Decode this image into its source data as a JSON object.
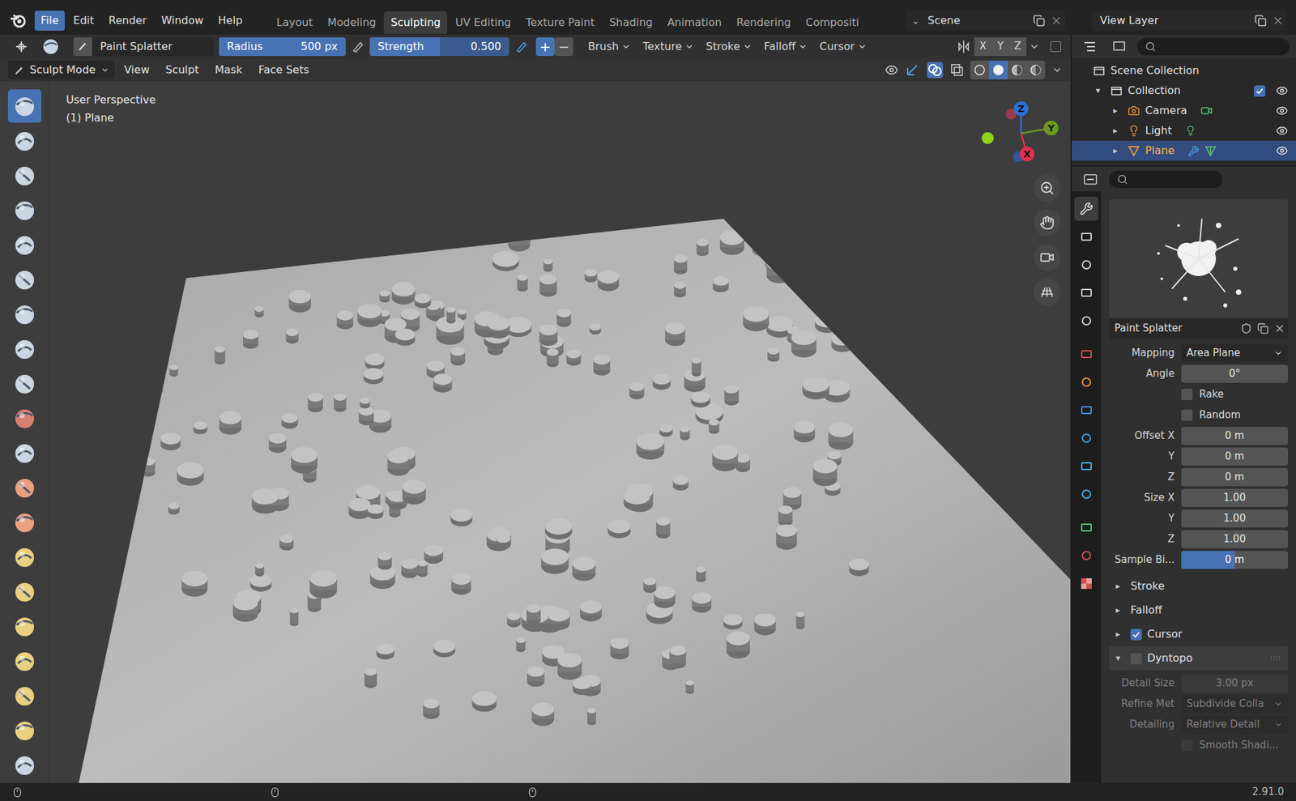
{
  "topbar": {
    "menus": [
      {
        "label": "File",
        "highlighted": true
      },
      {
        "label": "Edit",
        "highlighted": false
      },
      {
        "label": "Render",
        "highlighted": false
      },
      {
        "label": "Window",
        "highlighted": false
      },
      {
        "label": "Help",
        "highlighted": false
      }
    ],
    "workspaces": [
      {
        "label": "Layout",
        "selected": false
      },
      {
        "label": "Modeling",
        "selected": false
      },
      {
        "label": "Sculpting",
        "selected": true
      },
      {
        "label": "UV Editing",
        "selected": false
      },
      {
        "label": "Texture Paint",
        "selected": false
      },
      {
        "label": "Shading",
        "selected": false
      },
      {
        "label": "Animation",
        "selected": false
      },
      {
        "label": "Rendering",
        "selected": false
      },
      {
        "label": "Compositi",
        "selected": false
      }
    ],
    "scene": "Scene",
    "view_layer": "View Layer"
  },
  "tool_header": {
    "brush_name": "Paint Splatter",
    "radius": {
      "label": "Radius",
      "value": "500 px",
      "level": 1
    },
    "strength": {
      "label": "Strength",
      "value": "0.500",
      "level": 0.5
    },
    "direction": [
      {
        "label": "+",
        "selected": true
      },
      {
        "label": "−",
        "selected": false
      }
    ],
    "dropdowns": [
      "Brush",
      "Texture",
      "Stroke",
      "Falloff",
      "Cursor"
    ],
    "symmetry": [
      {
        "label": "X",
        "selected": false
      },
      {
        "label": "Y",
        "selected": false
      },
      {
        "label": "Z",
        "selected": false
      }
    ]
  },
  "mode_header": {
    "mode": "Sculpt Mode",
    "menus": [
      "View",
      "Sculpt",
      "Mask",
      "Face Sets"
    ],
    "shading": [
      {
        "selected": false
      },
      {
        "selected": true
      },
      {
        "selected": false
      },
      {
        "selected": false
      }
    ]
  },
  "toolbar": {
    "tools": [
      {
        "selected": true
      },
      {
        "selected": false
      },
      {
        "selected": false
      },
      {
        "selected": false
      },
      {
        "selected": false
      },
      {
        "selected": false
      },
      {
        "selected": false
      },
      {
        "selected": false
      },
      {
        "selected": false
      },
      {
        "selected": false
      },
      {
        "selected": false
      },
      {
        "selected": false
      },
      {
        "selected": false
      },
      {
        "selected": false
      },
      {
        "selected": false
      },
      {
        "selected": false
      },
      {
        "selected": false
      },
      {
        "selected": false
      },
      {
        "selected": false
      },
      {
        "selected": false
      }
    ]
  },
  "viewport": {
    "perspective": "User Perspective",
    "object": "(1) Plane",
    "gizmo": [
      "Z",
      "Y",
      "X"
    ]
  },
  "outliner": {
    "scene_collection": "Scene Collection",
    "collection": {
      "label": "Collection",
      "arrow": "▾",
      "checked": true,
      "visible": true
    },
    "objects": [
      {
        "label": "Camera",
        "arrow": "▸",
        "selected": false,
        "visible": true
      },
      {
        "label": "Light",
        "arrow": "▸",
        "selected": false,
        "visible": true
      },
      {
        "label": "Plane",
        "arrow": "▸",
        "selected": true,
        "visible": true
      }
    ]
  },
  "properties": {
    "tabs": [
      {
        "selected": true
      },
      {
        "selected": false
      },
      {
        "selected": false
      },
      {
        "selected": false
      },
      {
        "selected": false
      },
      {
        "selected": false
      },
      {
        "selected": false
      },
      {
        "selected": false
      },
      {
        "selected": false
      },
      {
        "selected": false
      },
      {
        "selected": false
      },
      {
        "selected": false
      },
      {
        "selected": false
      },
      {
        "selected": false
      }
    ],
    "texture_name": "Paint Splatter",
    "rows": [
      {
        "kind": "dropdown",
        "label": "Mapping",
        "value": "Area Plane"
      },
      {
        "kind": "field",
        "label": "Angle",
        "value": "0°"
      },
      {
        "kind": "checkbox",
        "label": "Rake",
        "checked": false
      },
      {
        "kind": "checkbox",
        "label": "Random",
        "checked": false
      },
      {
        "kind": "field",
        "label": "Offset X",
        "value": "0 m"
      },
      {
        "kind": "field",
        "label": "Y",
        "value": "0 m"
      },
      {
        "kind": "field",
        "label": "Z",
        "value": "0 m"
      },
      {
        "kind": "field",
        "label": "Size X",
        "value": "1.00"
      },
      {
        "kind": "field",
        "label": "Y",
        "value": "1.00"
      },
      {
        "kind": "field",
        "label": "Z",
        "value": "1.00"
      },
      {
        "kind": "slider",
        "label": "Sample Bi...",
        "value": "0 m",
        "level": 0.5
      }
    ],
    "panels": [
      {
        "label": "Stroke",
        "arrow": "▸",
        "expanded": false,
        "kind": "plain"
      },
      {
        "label": "Falloff",
        "arrow": "▸",
        "expanded": false,
        "kind": "plain"
      },
      {
        "label": "Cursor",
        "arrow": "▸",
        "expanded": false,
        "kind": "check",
        "checked": true
      },
      {
        "label": "Dyntopo",
        "arrow": "▾",
        "expanded": true,
        "kind": "check",
        "checked": false
      }
    ],
    "dyntopo_rows": [
      {
        "kind": "field",
        "label": "Detail Size",
        "value": "3.00 px",
        "disabled": true
      },
      {
        "kind": "dropdown",
        "label": "Refine Met",
        "value": "Subdivide Colla",
        "disabled": true
      },
      {
        "kind": "dropdown",
        "label": "Detailing",
        "value": "Relative Detail",
        "disabled": true
      },
      {
        "kind": "checkbox",
        "label": "Smooth Shadi...",
        "checked": false,
        "disabled": true
      }
    ]
  },
  "status_bar": {
    "version": "2.91.0"
  }
}
